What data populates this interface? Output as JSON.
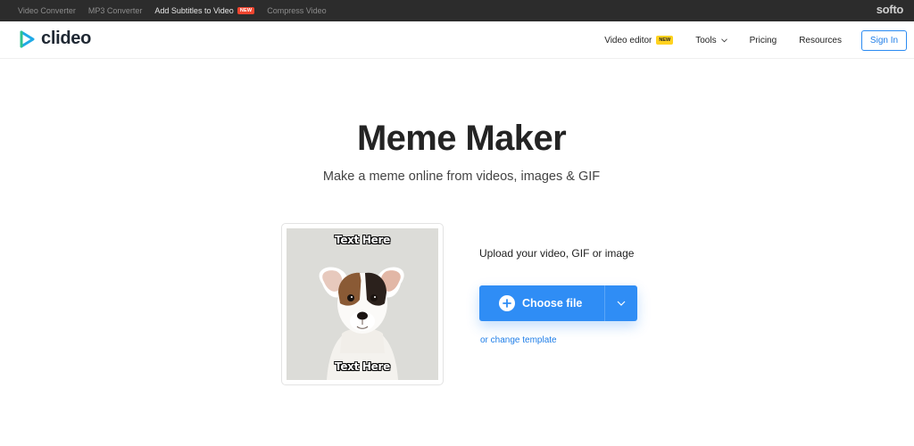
{
  "topbar": {
    "links": [
      {
        "label": "Video Converter",
        "active": false
      },
      {
        "label": "MP3 Converter",
        "active": false
      },
      {
        "label": "Add Subtitles to Video",
        "active": true,
        "badge": "NEW"
      },
      {
        "label": "Compress Video",
        "active": false
      }
    ],
    "brand": "softo"
  },
  "header": {
    "logo_text": "clideo",
    "nav": {
      "video_editor": "Video editor",
      "video_editor_badge": "NEW",
      "tools": "Tools",
      "pricing": "Pricing",
      "resources": "Resources",
      "sign_in": "Sign In"
    }
  },
  "hero": {
    "title": "Meme Maker",
    "subtitle": "Make a meme online from videos, images & GIF"
  },
  "preview": {
    "top_text": "Text Here",
    "bottom_text": "Text Here"
  },
  "upload": {
    "label": "Upload your video, GIF or image",
    "choose_file": "Choose file",
    "change_template": "or change template"
  },
  "colors": {
    "accent": "#2f8df5",
    "topbar_bg": "#2c2c2c",
    "new_red": "#f0452f",
    "new_yellow": "#ffd21f"
  },
  "icons": [
    "clideo-logo-icon",
    "chevron-down-icon",
    "plus-circle-icon",
    "dog-image"
  ]
}
